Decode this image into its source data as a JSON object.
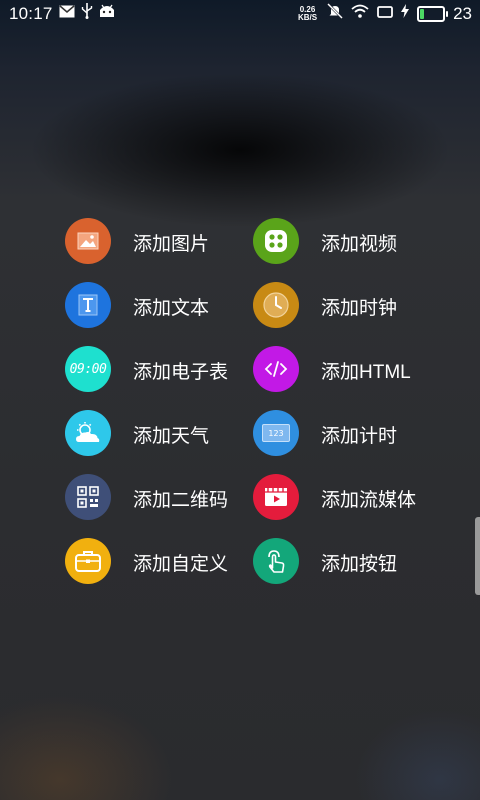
{
  "status_bar": {
    "time": "10:17",
    "net_speed_value": "0.26",
    "net_speed_unit": "KB/S",
    "battery_level": "23",
    "icons": [
      "mail-icon",
      "usb-icon",
      "android-icon",
      "mute-icon",
      "wifi-icon",
      "screen-icon",
      "charging-icon",
      "battery-icon"
    ]
  },
  "menu": {
    "items": [
      {
        "label": "添加图片",
        "icon": "image-icon",
        "color": "#d9622e"
      },
      {
        "label": "添加视频",
        "icon": "video-dots-icon",
        "color": "#5aa41a"
      },
      {
        "label": "添加文本",
        "icon": "text-icon",
        "color": "#1e74de"
      },
      {
        "label": "添加时钟",
        "icon": "clock-icon",
        "color": "#c88a14"
      },
      {
        "label": "添加电子表",
        "icon": "digital-clock-icon",
        "color": "#1ee0cf",
        "icon_text": "09:00"
      },
      {
        "label": "添加HTML",
        "icon": "code-icon",
        "color": "#c219e6"
      },
      {
        "label": "添加天气",
        "icon": "weather-icon",
        "color": "#2ec8ea"
      },
      {
        "label": "添加计时",
        "icon": "timer-icon",
        "color": "#2f8fe0",
        "icon_text": "123"
      },
      {
        "label": "添加二维码",
        "icon": "qrcode-icon",
        "color": "#3f4f78"
      },
      {
        "label": "添加流媒体",
        "icon": "stream-icon",
        "color": "#e41c3c"
      },
      {
        "label": "添加自定义",
        "icon": "briefcase-icon",
        "color": "#f1b00f"
      },
      {
        "label": "添加按钮",
        "icon": "touch-icon",
        "color": "#13a77a"
      }
    ]
  }
}
